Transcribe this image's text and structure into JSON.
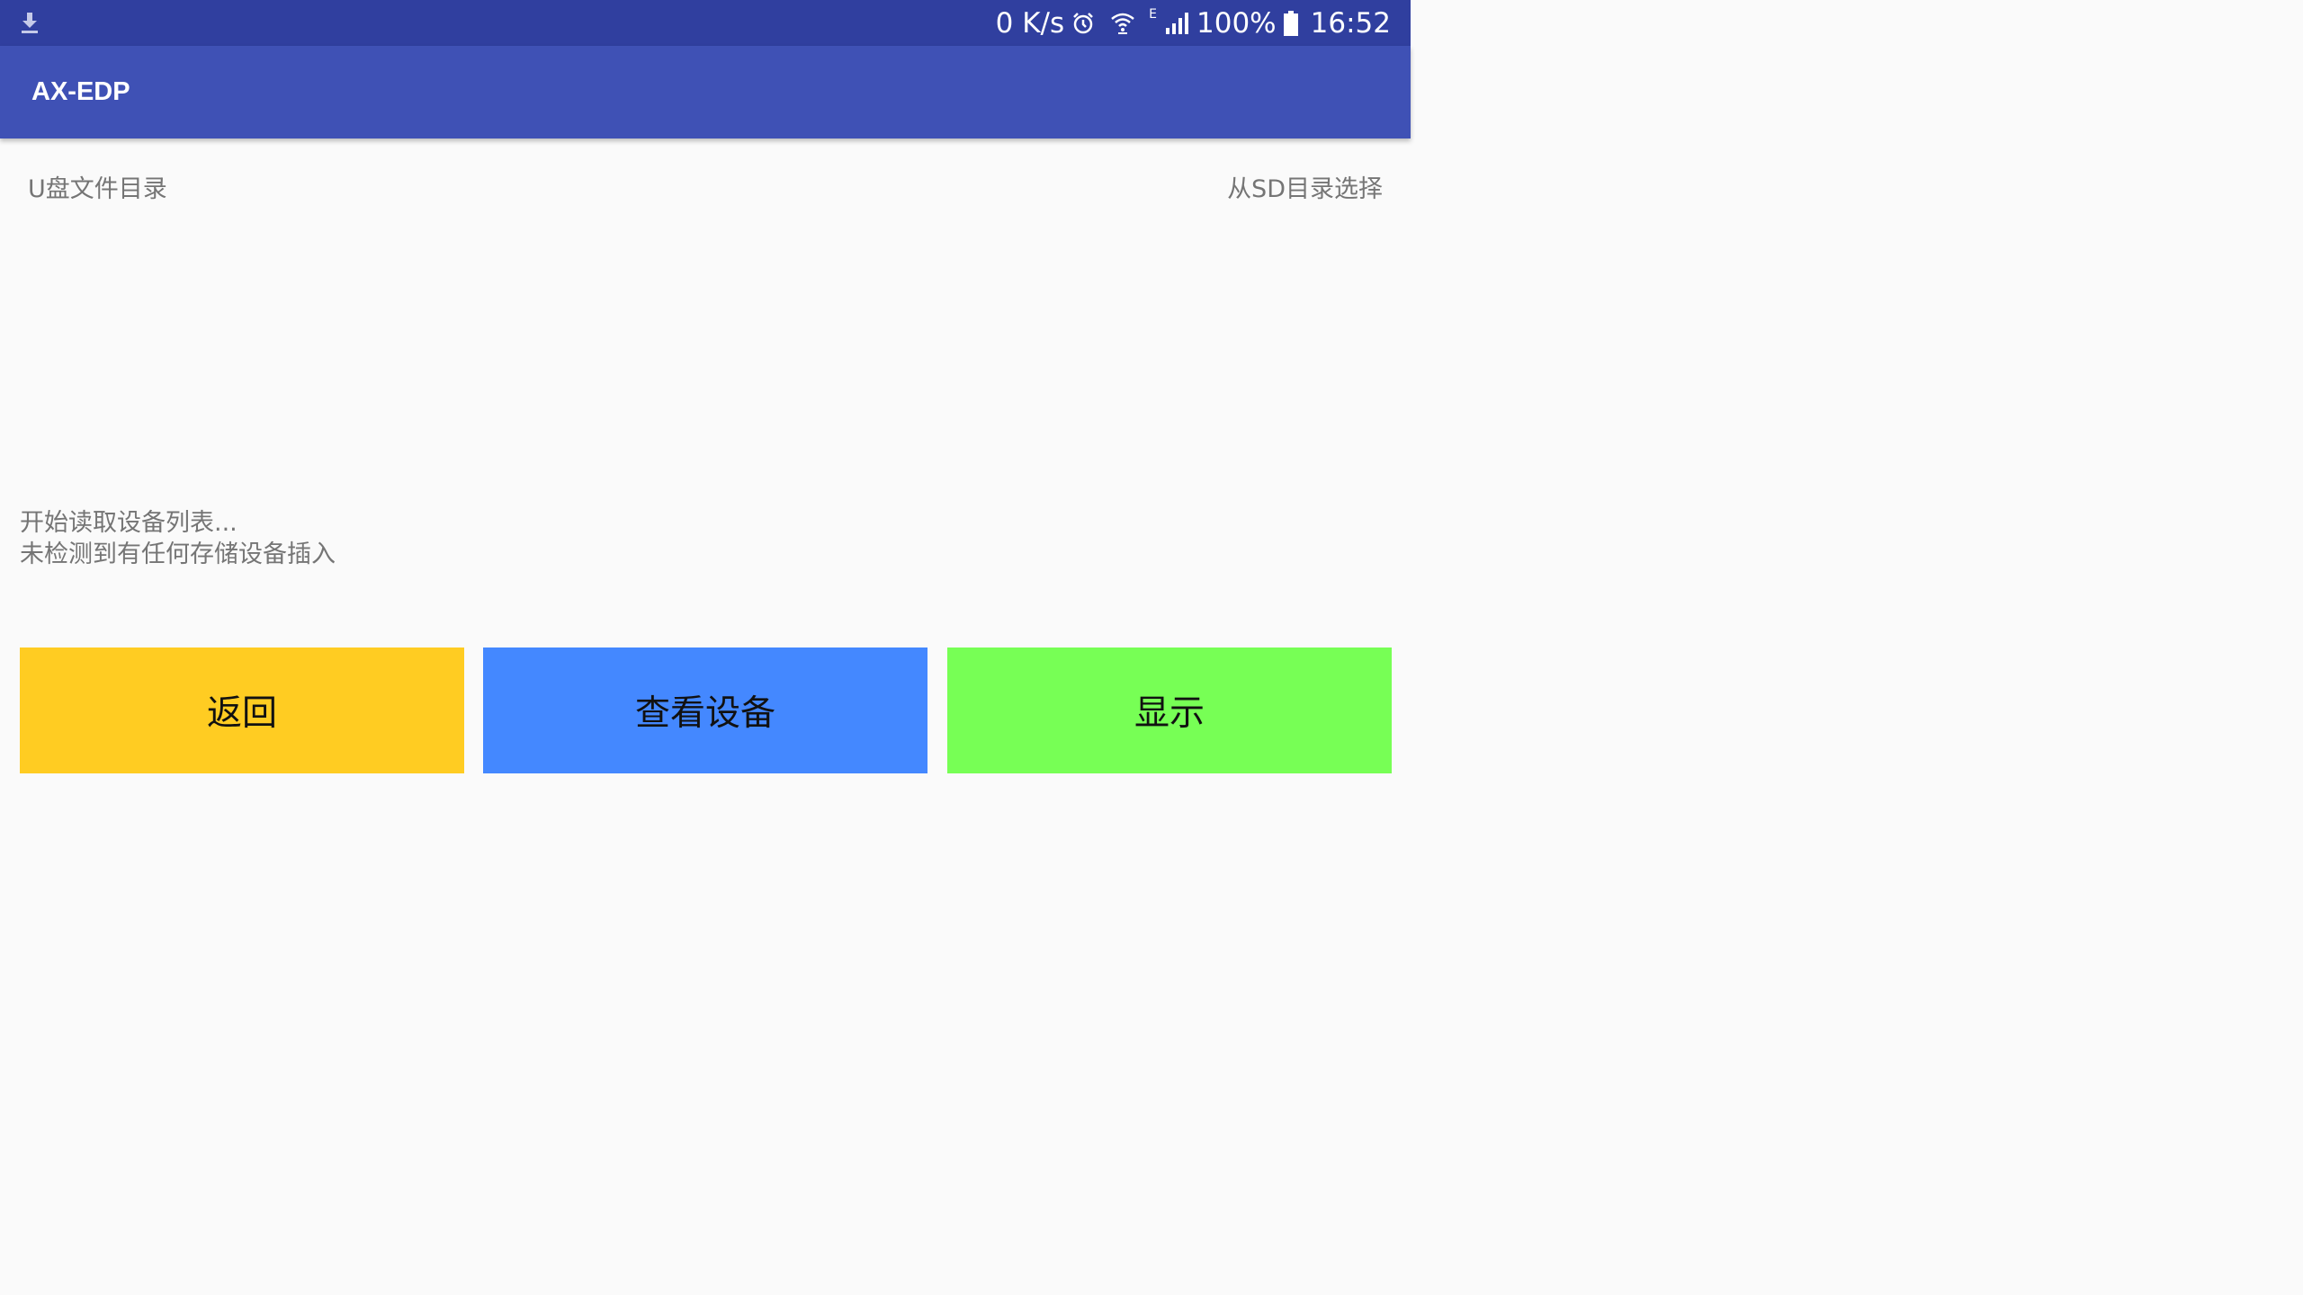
{
  "status_bar": {
    "speed": "0 K/s",
    "network_type": "E",
    "battery": "100%",
    "time": "16:52",
    "icons": [
      "download-icon",
      "alarm-icon",
      "wifi-icon",
      "signal-icon",
      "battery-icon"
    ]
  },
  "app_bar": {
    "title": "AX-EDP"
  },
  "main": {
    "left_header": "U盘文件目录",
    "right_link": "从SD目录选择",
    "log_lines": [
      "开始读取设备列表...",
      "未检测到有任何存储设备插入"
    ]
  },
  "buttons": {
    "back": "返回",
    "view_devices": "查看设备",
    "show": "显示"
  },
  "colors": {
    "status_bar": "#303f9f",
    "app_bar": "#3f51b5",
    "back_button": "#ffcc22",
    "view_devices_button": "#4488ff",
    "show_button": "#77ff55"
  }
}
